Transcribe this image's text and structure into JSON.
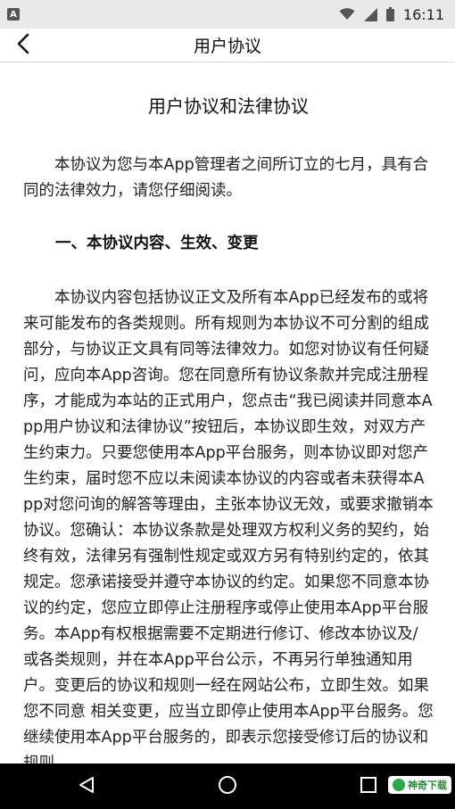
{
  "status_bar": {
    "notification": "A",
    "time": "16:11"
  },
  "app_bar": {
    "title": "用户协议"
  },
  "document": {
    "title": "用户协议和法律协议",
    "intro": "本协议为您与本App管理者之间所订立的七月，具有合同的法律效力，请您仔细阅读。",
    "section1_heading": "一、本协议内容、生效、变更",
    "section1_body": "本协议内容包括协议正文及所有本App已经发布的或将来可能发布的各类规则。所有规则为本协议不可分割的组成部分，与协议正文具有同等法律效力。如您对协议有任何疑问，应向本App咨询。您在同意所有协议条款并完成注册程序，才能成为本站的正式用户，您点击“我已阅读并同意本App用户协议和法律协议”按钮后，本协议即生效，对双方产生约束力。只要您使用本App平台服务，则本协议即对您产生约束，届时您不应以未阅读本协议的内容或者未获得本App对您问询的解答等理由，主张本协议无效，或要求撤销本协议。您确认：本协议条款是处理双方权利义务的契约，始终有效，法律另有强制性规定或双方另有特别约定的，依其规定。您承诺接受并遵守本协议的约定。如果您不同意本协议的约定，您应立即停止注册程序或停止使用本App平台服务。本App有权根据需要不定期进行修订、修改本协议及/或各类规则，并在本App平台公示，不再另行单独通知用户。变更后的协议和规则一经在网站公布，立即生效。如果您不同意 相关变更，应当立即停止使用本App平台服务。您继续使用本App平台服务的，即表示您接受修订后的协议和规则。"
  },
  "watermark": {
    "text": "神奇下载"
  },
  "colors": {
    "status_bar_bg": "#e9e9e9",
    "nav_bar_bg": "#000000",
    "divider": "#d6d6d6"
  }
}
